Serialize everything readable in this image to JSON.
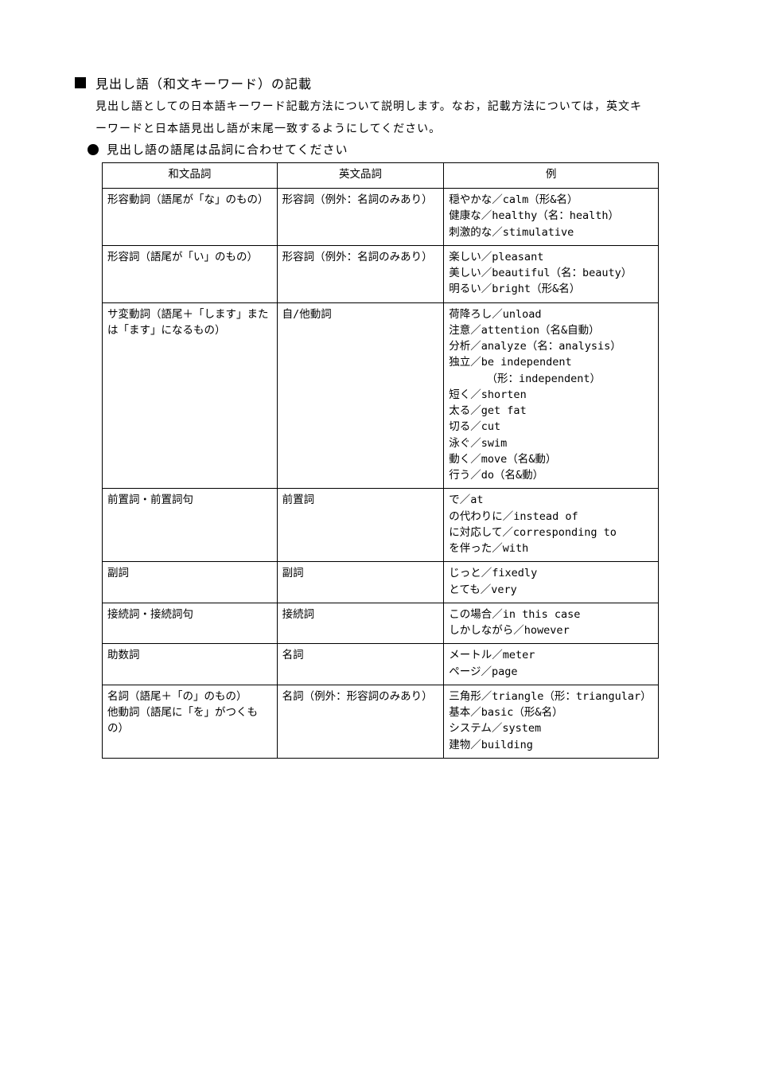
{
  "header": {
    "title": "見出し語（和文キーワード）の記載",
    "body": "見出し語としての日本語キーワード記載方法について説明します。なお，記載方法については，英文キーワードと日本語見出し語が末尾一致するようにしてください。"
  },
  "subsection": {
    "title": "見出し語の語尾は品詞に合わせてください"
  },
  "table": {
    "head": {
      "c1": "和文品詞",
      "c2": "英文品詞",
      "c3": "例"
    },
    "rows": [
      {
        "c1": "形容動詞（語尾が「な」のもの）",
        "c2": "形容詞（例外：名詞のみあり）",
        "c3": "穏やかな／calm（形&名）\n健康な／healthy（名：health）\n刺激的な／stimulative"
      },
      {
        "c1": "形容詞（語尾が「い」のもの）",
        "c2": "形容詞（例外：名詞のみあり）",
        "c3": "楽しい／pleasant\n美しい／beautiful（名：beauty）\n明るい／bright（形&名）"
      },
      {
        "c1": "サ変動詞（語尾＋「します」または「ます」になるもの）",
        "c2": "自/他動詞",
        "c3": "荷降ろし／unload\n注意／attention（名&自動）\n分析／analyze（名：analysis）\n独立／be independent\n　　　　（形：independent）\n短く／shorten\n太る／get fat\n切る／cut\n泳ぐ／swim\n動く／move（名&動）\n行う／do（名&動）"
      },
      {
        "c1": "前置詞・前置詞句",
        "c2": "前置詞",
        "c3": "で／at\nの代わりに／instead of\nに対応して／corresponding to\nを伴った／with"
      },
      {
        "c1": "副詞",
        "c2": "副詞",
        "c3": "じっと／fixedly\nとても／very"
      },
      {
        "c1": "接続詞・接続詞句",
        "c2": "接続詞",
        "c3": "この場合／in this case\nしかしながら／however"
      },
      {
        "c1": "助数詞",
        "c2": "名詞",
        "c3": "メートル／meter\nページ／page"
      },
      {
        "c1": "名詞（語尾＋「の」のもの）\n\n他動詞（語尾に「を」がつくもの）",
        "c2": "名詞（例外：形容詞のみあり）",
        "c3": "三角形／triangle（形：triangular）\n基本／basic（形&名）\nシステム／system\n建物／building"
      }
    ]
  }
}
